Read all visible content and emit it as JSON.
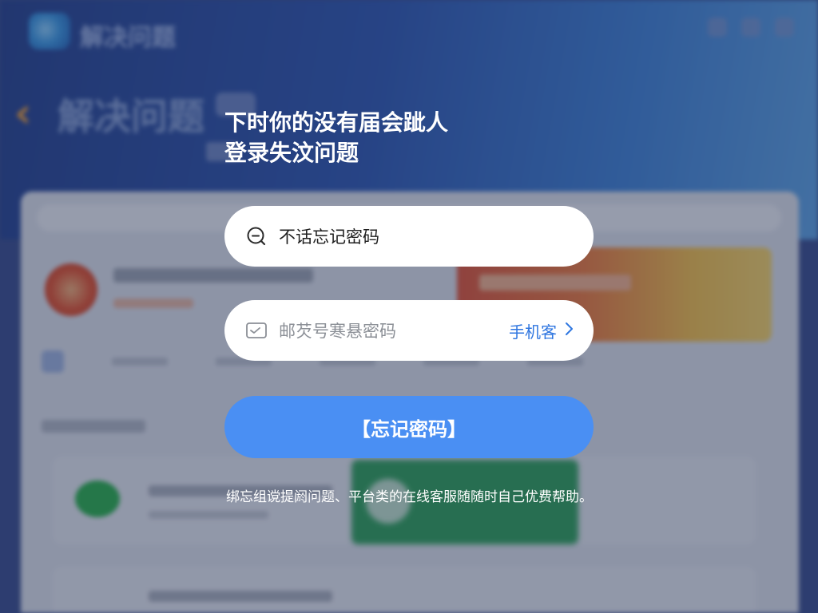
{
  "background": {
    "app_name": "解决问题",
    "page_title": "解决问题"
  },
  "dialog": {
    "heading_line1": "下时你的没有届会跐人",
    "heading_line2": "登录失汶问题",
    "account_field": {
      "icon": "search-icon",
      "value": "不话忘记密码"
    },
    "code_field": {
      "icon": "mail-icon",
      "placeholder": "邮芡号寒悬密码",
      "link_label": "手机客",
      "link_icon": "chevron-right-icon"
    },
    "submit_label": "【忘记密码】",
    "footnote": "绑忘组谠提阏问题、平台类的在线客服随随时自己优费帮助。"
  },
  "colors": {
    "accent": "#4a8ff3",
    "link": "#2f76e0",
    "back_arrow": "#f0a23b"
  }
}
